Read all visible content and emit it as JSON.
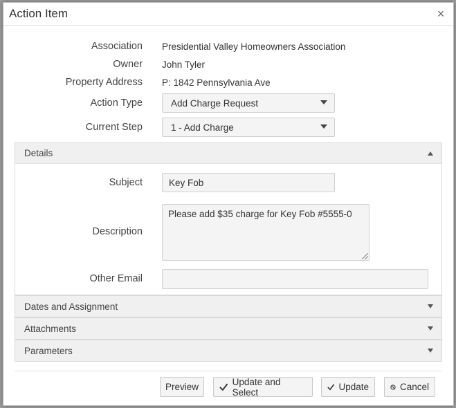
{
  "dialog": {
    "title": "Action Item",
    "close_symbol": "×"
  },
  "fields": {
    "association_label": "Association",
    "association_value": "Presidential Valley Homeowners Association",
    "owner_label": "Owner",
    "owner_value": "John Tyler",
    "property_label": "Property Address",
    "property_value": "P: 1842 Pennsylvania Ave",
    "action_type_label": "Action Type",
    "action_type_value": "Add Charge Request",
    "current_step_label": "Current Step",
    "current_step_value": "1 - Add Charge"
  },
  "details": {
    "header": "Details",
    "subject_label": "Subject",
    "subject_value": "Key Fob",
    "description_label": "Description",
    "description_value": "Please add $35 charge for Key Fob #5555-0",
    "other_email_label": "Other Email",
    "other_email_value": ""
  },
  "panels": {
    "dates_header": "Dates and Assignment",
    "attachments_header": "Attachments",
    "parameters_header": "Parameters"
  },
  "buttons": {
    "preview": "Preview",
    "update_and_select": "Update and Select",
    "update": "Update",
    "cancel": "Cancel"
  },
  "icons": {
    "close": "close-icon",
    "dropdown": "chevron-down-icon",
    "collapse": "chevron-up-icon",
    "check": "check-icon",
    "cancel": "ban-icon"
  }
}
